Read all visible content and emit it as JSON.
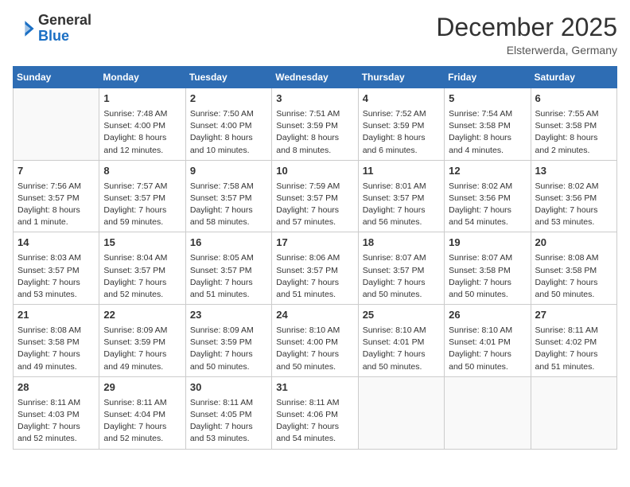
{
  "header": {
    "logo_general": "General",
    "logo_blue": "Blue",
    "month_title": "December 2025",
    "location": "Elsterwerda, Germany"
  },
  "days_of_week": [
    "Sunday",
    "Monday",
    "Tuesday",
    "Wednesday",
    "Thursday",
    "Friday",
    "Saturday"
  ],
  "weeks": [
    [
      {
        "day": null
      },
      {
        "day": "1",
        "sunrise": "7:48 AM",
        "sunset": "4:00 PM",
        "daylight": "8 hours and 12 minutes."
      },
      {
        "day": "2",
        "sunrise": "7:50 AM",
        "sunset": "4:00 PM",
        "daylight": "8 hours and 10 minutes."
      },
      {
        "day": "3",
        "sunrise": "7:51 AM",
        "sunset": "3:59 PM",
        "daylight": "8 hours and 8 minutes."
      },
      {
        "day": "4",
        "sunrise": "7:52 AM",
        "sunset": "3:59 PM",
        "daylight": "8 hours and 6 minutes."
      },
      {
        "day": "5",
        "sunrise": "7:54 AM",
        "sunset": "3:58 PM",
        "daylight": "8 hours and 4 minutes."
      },
      {
        "day": "6",
        "sunrise": "7:55 AM",
        "sunset": "3:58 PM",
        "daylight": "8 hours and 2 minutes."
      }
    ],
    [
      {
        "day": "7",
        "sunrise": "7:56 AM",
        "sunset": "3:57 PM",
        "daylight": "8 hours and 1 minute."
      },
      {
        "day": "8",
        "sunrise": "7:57 AM",
        "sunset": "3:57 PM",
        "daylight": "7 hours and 59 minutes."
      },
      {
        "day": "9",
        "sunrise": "7:58 AM",
        "sunset": "3:57 PM",
        "daylight": "7 hours and 58 minutes."
      },
      {
        "day": "10",
        "sunrise": "7:59 AM",
        "sunset": "3:57 PM",
        "daylight": "7 hours and 57 minutes."
      },
      {
        "day": "11",
        "sunrise": "8:01 AM",
        "sunset": "3:57 PM",
        "daylight": "7 hours and 56 minutes."
      },
      {
        "day": "12",
        "sunrise": "8:02 AM",
        "sunset": "3:56 PM",
        "daylight": "7 hours and 54 minutes."
      },
      {
        "day": "13",
        "sunrise": "8:02 AM",
        "sunset": "3:56 PM",
        "daylight": "7 hours and 53 minutes."
      }
    ],
    [
      {
        "day": "14",
        "sunrise": "8:03 AM",
        "sunset": "3:57 PM",
        "daylight": "7 hours and 53 minutes."
      },
      {
        "day": "15",
        "sunrise": "8:04 AM",
        "sunset": "3:57 PM",
        "daylight": "7 hours and 52 minutes."
      },
      {
        "day": "16",
        "sunrise": "8:05 AM",
        "sunset": "3:57 PM",
        "daylight": "7 hours and 51 minutes."
      },
      {
        "day": "17",
        "sunrise": "8:06 AM",
        "sunset": "3:57 PM",
        "daylight": "7 hours and 51 minutes."
      },
      {
        "day": "18",
        "sunrise": "8:07 AM",
        "sunset": "3:57 PM",
        "daylight": "7 hours and 50 minutes."
      },
      {
        "day": "19",
        "sunrise": "8:07 AM",
        "sunset": "3:58 PM",
        "daylight": "7 hours and 50 minutes."
      },
      {
        "day": "20",
        "sunrise": "8:08 AM",
        "sunset": "3:58 PM",
        "daylight": "7 hours and 50 minutes."
      }
    ],
    [
      {
        "day": "21",
        "sunrise": "8:08 AM",
        "sunset": "3:58 PM",
        "daylight": "7 hours and 49 minutes."
      },
      {
        "day": "22",
        "sunrise": "8:09 AM",
        "sunset": "3:59 PM",
        "daylight": "7 hours and 49 minutes."
      },
      {
        "day": "23",
        "sunrise": "8:09 AM",
        "sunset": "3:59 PM",
        "daylight": "7 hours and 50 minutes."
      },
      {
        "day": "24",
        "sunrise": "8:10 AM",
        "sunset": "4:00 PM",
        "daylight": "7 hours and 50 minutes."
      },
      {
        "day": "25",
        "sunrise": "8:10 AM",
        "sunset": "4:01 PM",
        "daylight": "7 hours and 50 minutes."
      },
      {
        "day": "26",
        "sunrise": "8:10 AM",
        "sunset": "4:01 PM",
        "daylight": "7 hours and 50 minutes."
      },
      {
        "day": "27",
        "sunrise": "8:11 AM",
        "sunset": "4:02 PM",
        "daylight": "7 hours and 51 minutes."
      }
    ],
    [
      {
        "day": "28",
        "sunrise": "8:11 AM",
        "sunset": "4:03 PM",
        "daylight": "7 hours and 52 minutes."
      },
      {
        "day": "29",
        "sunrise": "8:11 AM",
        "sunset": "4:04 PM",
        "daylight": "7 hours and 52 minutes."
      },
      {
        "day": "30",
        "sunrise": "8:11 AM",
        "sunset": "4:05 PM",
        "daylight": "7 hours and 53 minutes."
      },
      {
        "day": "31",
        "sunrise": "8:11 AM",
        "sunset": "4:06 PM",
        "daylight": "7 hours and 54 minutes."
      },
      {
        "day": null
      },
      {
        "day": null
      },
      {
        "day": null
      }
    ]
  ]
}
